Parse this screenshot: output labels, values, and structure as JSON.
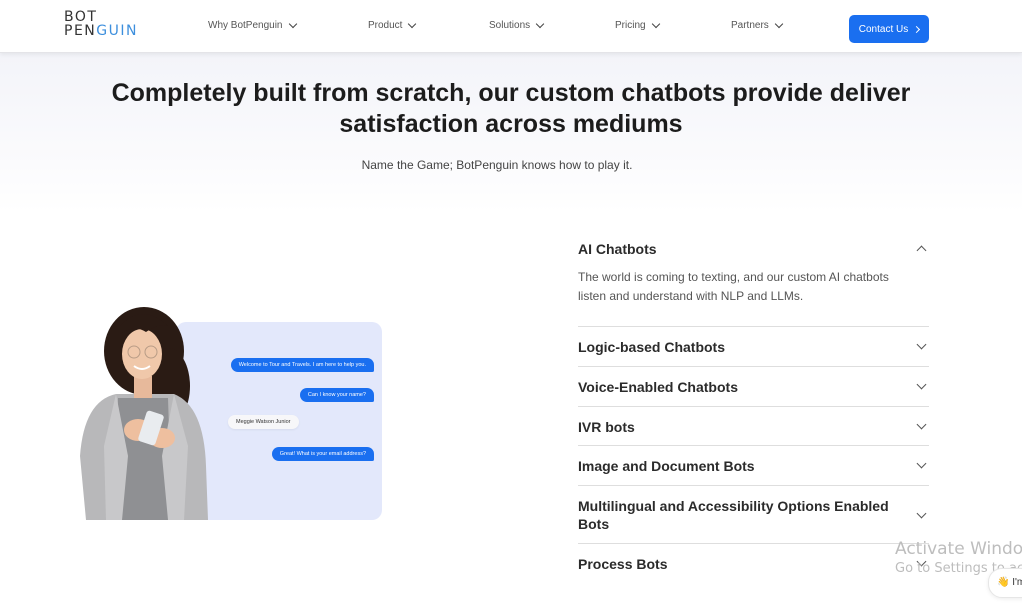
{
  "header": {
    "logo_top": "BOT",
    "logo_bottom_a": "PEN",
    "logo_bottom_b": "GUIN",
    "nav": [
      {
        "label": "Why BotPenguin"
      },
      {
        "label": "Product"
      },
      {
        "label": "Solutions"
      },
      {
        "label": "Pricing"
      },
      {
        "label": "Partners"
      }
    ],
    "contact_label": "Contact Us"
  },
  "hero": {
    "title": "Completely built from scratch, our custom chatbots provide deliver satisfaction across mediums",
    "subtitle": "Name the Game; BotPenguin knows how to play it."
  },
  "illustration": {
    "messages": [
      {
        "from": "bot",
        "text": "Welcome to Tour and Travels. I am here to help you."
      },
      {
        "from": "bot",
        "text": "Can I know your name?"
      },
      {
        "from": "user",
        "text": "Meggie Watson Junior"
      },
      {
        "from": "bot",
        "text": "Great! What is your email address?"
      }
    ]
  },
  "accordion": [
    {
      "title": "AI Chatbots",
      "expanded": true,
      "description": "The world is coming to texting, and our custom AI chatbots listen and understand with NLP and LLMs."
    },
    {
      "title": "Logic-based Chatbots",
      "expanded": false
    },
    {
      "title": "Voice-Enabled Chatbots",
      "expanded": false
    },
    {
      "title": "IVR bots",
      "expanded": false
    },
    {
      "title": "Image and Document Bots",
      "expanded": false
    },
    {
      "title": "Multilingual and Accessibility Options Enabled Bots",
      "expanded": false
    },
    {
      "title": "Process Bots",
      "expanded": false
    }
  ],
  "watermark": {
    "line1": "Activate Windows",
    "line2": "Go to Settings to activate Windows."
  },
  "chat_widget": {
    "icon": "waving-hand-icon",
    "text": "I'm"
  },
  "colors": {
    "brand_blue": "#1a6ff0",
    "logo_blue": "#3d8fdd",
    "panel_bg": "#e3e8fb"
  }
}
